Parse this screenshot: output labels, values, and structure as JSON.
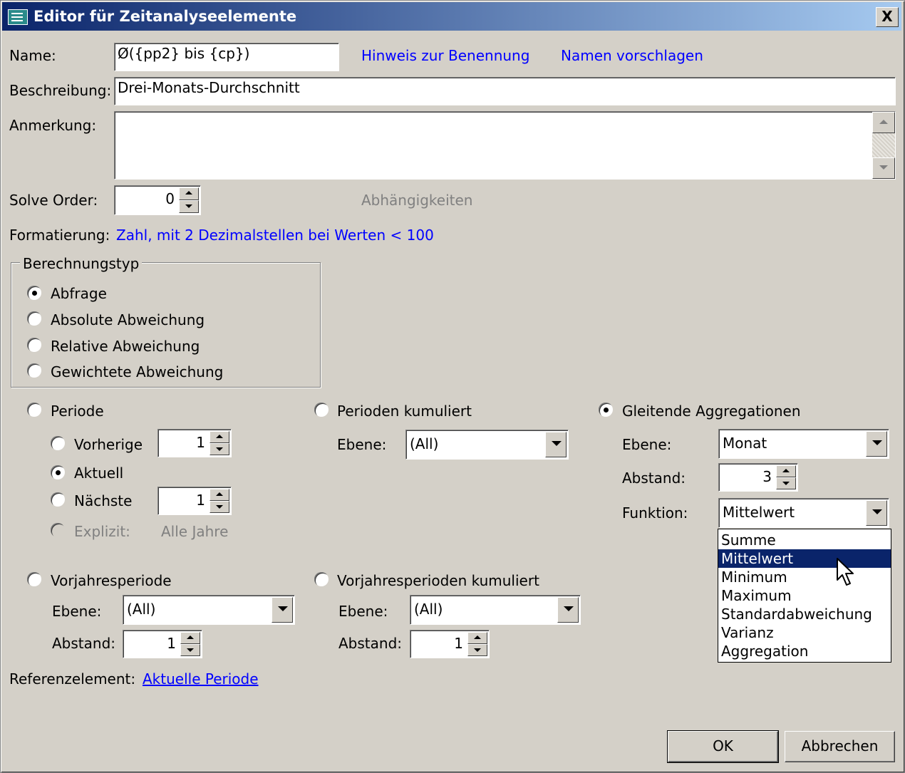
{
  "window": {
    "title": "Editor für Zeitanalyseelemente",
    "close_label": "X"
  },
  "name": {
    "label": "Name:",
    "value": "Ø({pp2} bis {cp})",
    "hint_link": "Hinweis zur Benennung",
    "suggest_link": "Namen vorschlagen"
  },
  "description": {
    "label": "Beschreibung:",
    "value": "Drei-Monats-Durchschnitt"
  },
  "note": {
    "label": "Anmerkung:",
    "value": ""
  },
  "solve_order": {
    "label": "Solve Order:",
    "value": "0",
    "dependencies_link": "Abhängigkeiten"
  },
  "format": {
    "label": "Formatierung:",
    "value": "Zahl, mit 2 Dezimalstellen bei Werten  < 100"
  },
  "calc_type": {
    "legend": "Berechnungstyp",
    "options": [
      "Abfrage",
      "Absolute Abweichung",
      "Relative Abweichung",
      "Gewichtete Abweichung"
    ],
    "selected": "Abfrage"
  },
  "period": {
    "label": "Periode",
    "previous": {
      "label": "Vorherige",
      "value": "1"
    },
    "current": {
      "label": "Aktuell"
    },
    "next": {
      "label": "Nächste",
      "value": "1"
    },
    "explicit": {
      "label": "Explizit:",
      "value": "Alle Jahre"
    }
  },
  "cumulative": {
    "label": "Perioden kumuliert",
    "level_label": "Ebene:",
    "level_value": "(All)"
  },
  "rolling": {
    "label": "Gleitende Aggregationen",
    "level_label": "Ebene:",
    "level_value": "Monat",
    "distance_label": "Abstand:",
    "distance_value": "3",
    "function_label": "Funktion:",
    "function_value": "Mittelwert",
    "function_options": [
      "Summe",
      "Mittelwert",
      "Minimum",
      "Maximum",
      "Standardabweichung",
      "Varianz",
      "Aggregation"
    ]
  },
  "prev_year": {
    "label": "Vorjahresperiode",
    "level_label": "Ebene:",
    "level_value": "(All)",
    "distance_label": "Abstand:",
    "distance_value": "1"
  },
  "prev_year_cum": {
    "label": "Vorjahresperioden kumuliert",
    "level_label": "Ebene:",
    "level_value": "(All)",
    "distance_label": "Abstand:",
    "distance_value": "1"
  },
  "reference": {
    "label": "Referenzelement:",
    "link": "Aktuelle Periode"
  },
  "buttons": {
    "ok": "OK",
    "cancel": "Abbrechen"
  },
  "colors": {
    "title_start": "#0a246a",
    "title_end": "#a6caf0",
    "link": "#0000ff",
    "selection": "#0a246a",
    "face": "#d4d0c8"
  }
}
